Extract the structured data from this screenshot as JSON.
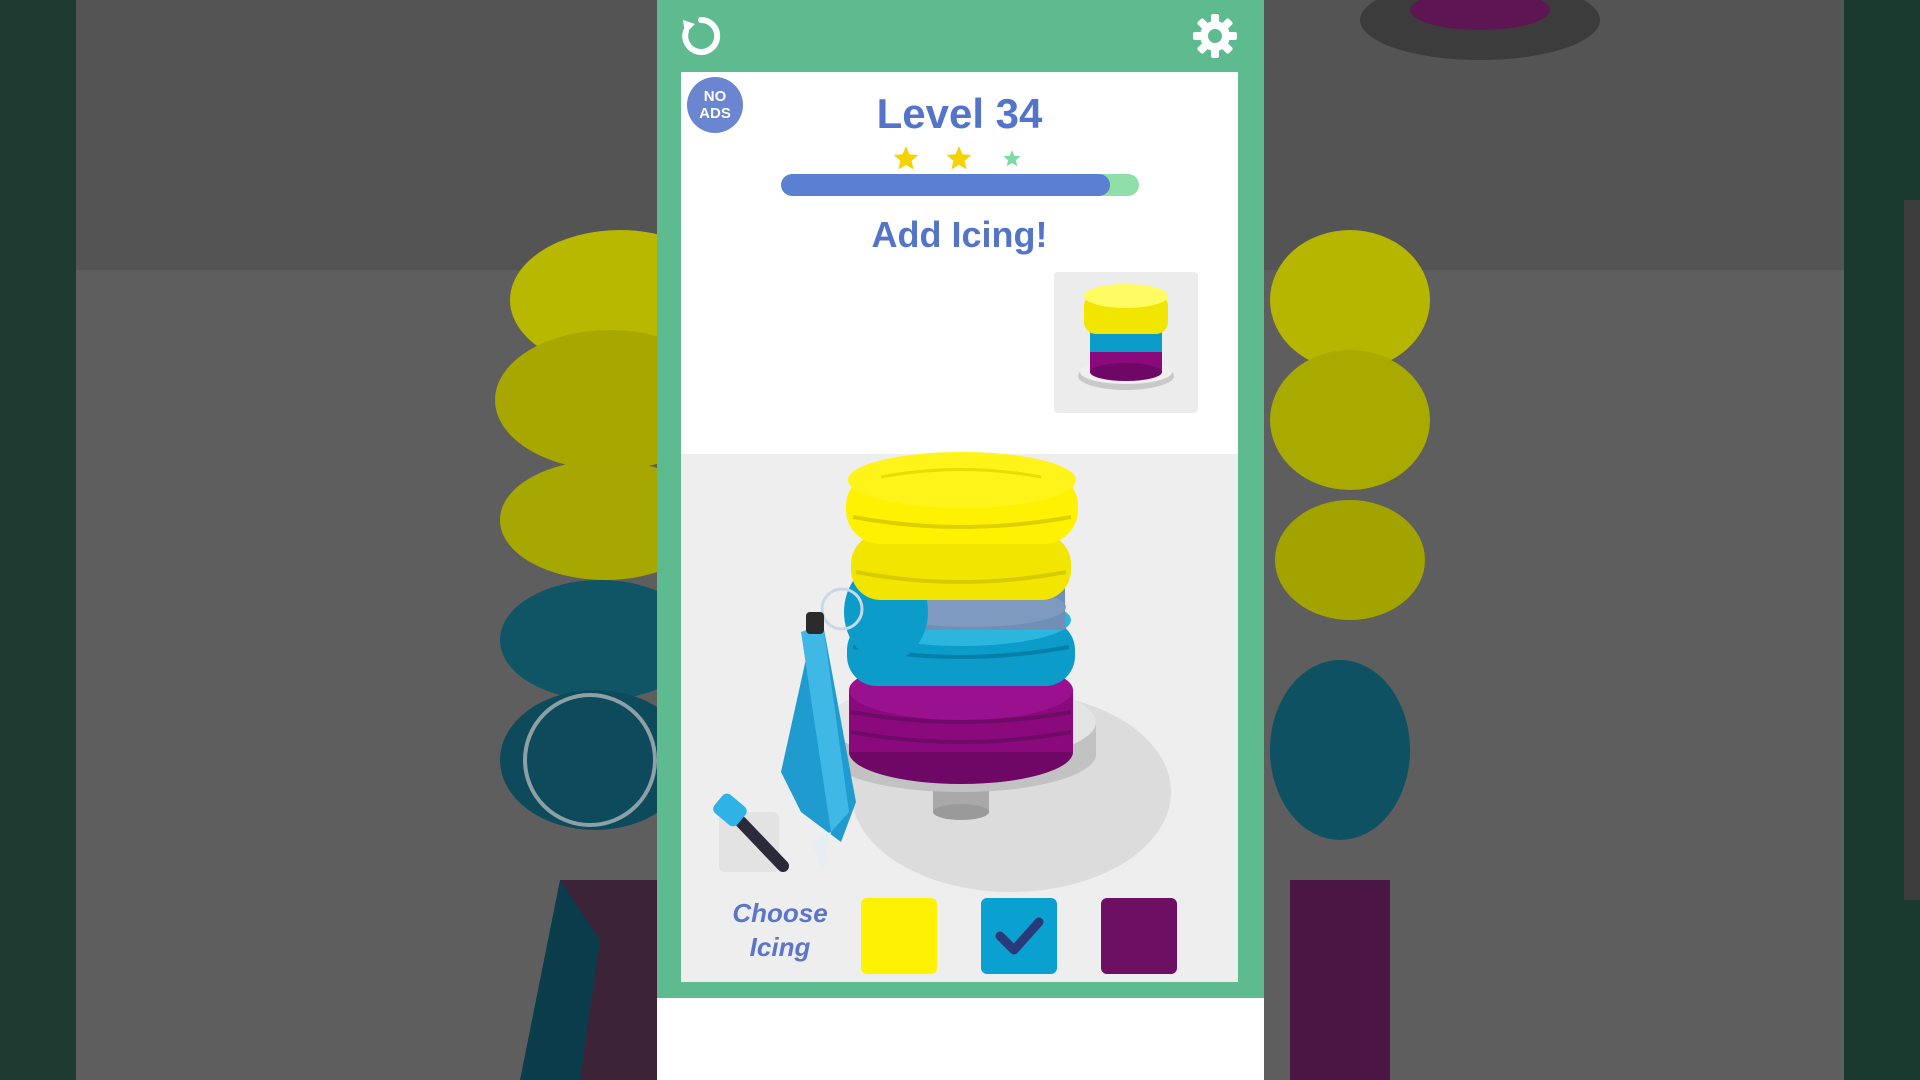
{
  "header": {
    "level_title": "Level 34",
    "no_ads_line1": "NO",
    "no_ads_line2": "ADS",
    "stars_earned": 2,
    "stars_total": 3,
    "progress": 0.92,
    "instruction": "Add Icing!"
  },
  "icing": {
    "choose_line1": "Choose",
    "choose_line2": "Icing",
    "swatches": [
      {
        "color": "#fff200",
        "selected": false
      },
      {
        "color": "#0aa0cf",
        "selected": true
      },
      {
        "color": "#6d0f62",
        "selected": false
      }
    ]
  },
  "colors": {
    "frame": "#5dbb8f",
    "accent_blue": "#5374c9",
    "star_gold": "#f5d300",
    "star_empty": "#7fdba3",
    "yellow_icing": "#fff200",
    "cyan_icing": "#0aa0cf",
    "magenta_icing": "#8b0a7c"
  },
  "icons": {
    "reload": "reload-icon",
    "settings": "gear-icon",
    "check": "check-icon",
    "tool": "spatula-icon"
  }
}
